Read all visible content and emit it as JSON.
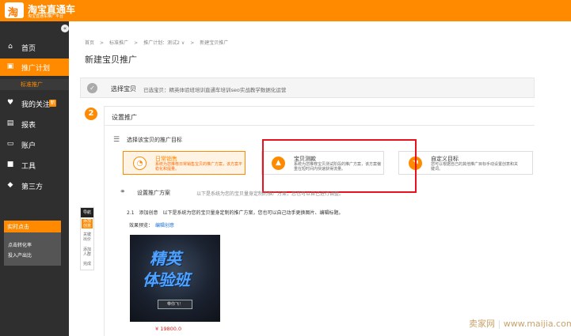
{
  "header": {
    "app_title": "淘宝直通车",
    "app_subtitle": "淘宝直通车推广平台"
  },
  "sidebar": {
    "collapse_glyph": "«",
    "items": [
      {
        "label": "首页",
        "icon": "home-icon"
      },
      {
        "label": "推广计划",
        "icon": "briefcase-icon"
      },
      {
        "label": "我的关注",
        "icon": "heart-icon",
        "badge": "新"
      },
      {
        "label": "报表",
        "icon": "report-icon"
      },
      {
        "label": "账户",
        "icon": "account-icon"
      },
      {
        "label": "工具",
        "icon": "toolbox-icon"
      },
      {
        "label": "第三方",
        "icon": "diamond-icon"
      }
    ],
    "subitem": "标准推广",
    "realtime": {
      "title": "实时点击",
      "links": [
        "点击转化率",
        "投入产出比"
      ]
    }
  },
  "breadcrumb": [
    "首页",
    ">",
    "标准推广",
    ">",
    "推广计划：测试2 ∨",
    ">",
    "新建宝贝推广"
  ],
  "page_title": "新建宝贝推广",
  "step1": {
    "label": "选择宝贝",
    "detail": "已选宝贝：精英体验班培训直通车培训seo实战教学数据化运营"
  },
  "step2": {
    "number": "2",
    "label": "设置推广",
    "goal_label": "选择该宝贝的推广目标",
    "goals": [
      {
        "title": "日常销售",
        "desc": "系统为您推荐日常销售宝贝的推广方案，该方案平稳化和提量。",
        "selected": true
      },
      {
        "title": "宝贝测款",
        "desc": "系统为您推荐宝贝测试阶段的推广方案，该方案偏重在短时间内快速获得流量。",
        "selected": false
      },
      {
        "title": "自定义目标",
        "desc": "您可以根据自己的其他推广目标手动设置创意和关键词。",
        "selected": false
      }
    ],
    "plan_label": "设置推广方案",
    "plan_desc": "以下是系统为您的宝贝量身定制的推广方案，您也可以自己进行调整。",
    "sub_step": "2.1　添加创意　以下是系统为您的宝贝量身定制的推广方案，您也可以自己动手更换图片、编辑标题。",
    "preview_label": "效果预览：",
    "preview_link": "编辑创意",
    "creative": {
      "line1": "精英",
      "line2": "体验班",
      "button": "带你飞！"
    },
    "price": "¥ 19800.0"
  },
  "float_nav": {
    "head": "导航",
    "items": [
      "添加创意",
      "关键出价",
      "添加人群",
      "完成"
    ]
  },
  "watermark": {
    "brand": "卖家网",
    "sep": "|",
    "url": "www.maijia.com"
  },
  "colors": {
    "brand_orange": "#ff8a00",
    "sidebar_bg": "#2f2f2f",
    "highlight_red": "#e8121c"
  }
}
